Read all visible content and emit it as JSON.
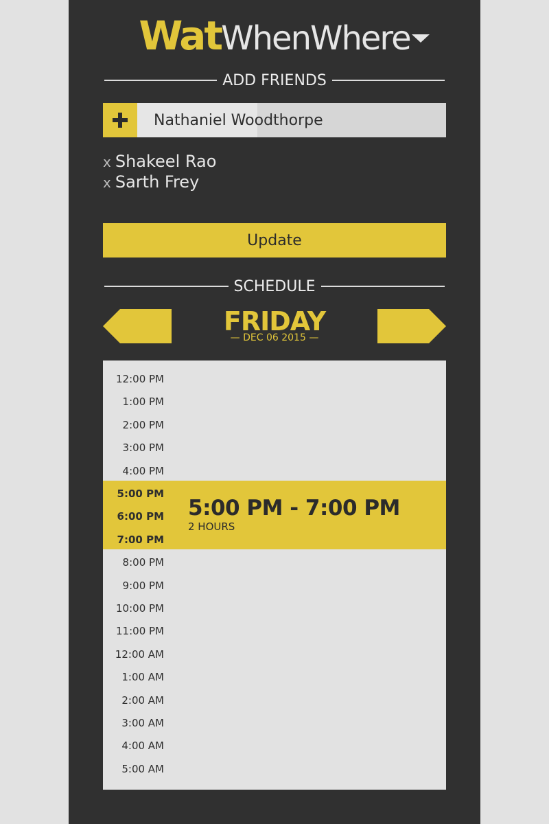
{
  "app": {
    "logo_wat": "Wat",
    "logo_rest": "WhenWhere",
    "accent": "#e2c63a",
    "background": "#303030"
  },
  "add_friends": {
    "heading": "ADD FRIENDS",
    "add_icon": "plus-icon",
    "input_value": "Nathaniel Woodthorpe",
    "friends": [
      {
        "remove_glyph": "x",
        "name": "Shakeel Rao"
      },
      {
        "remove_glyph": "x",
        "name": "Sarth Frey"
      }
    ],
    "update_label": "Update"
  },
  "schedule": {
    "heading": "SCHEDULE",
    "day": "FRIDAY",
    "date": "— DEC 06 2015 —",
    "prev_icon": "arrow-left-icon",
    "next_icon": "arrow-right-icon",
    "times": [
      "12:00 PM",
      "1:00 PM",
      "2:00 PM",
      "3:00 PM",
      "4:00 PM",
      "5:00 PM",
      "6:00 PM",
      "7:00 PM",
      "8:00 PM",
      "9:00 PM",
      "10:00 PM",
      "11:00 PM",
      "12:00 AM",
      "1:00 AM",
      "2:00 AM",
      "3:00 AM",
      "4:00 AM",
      "5:00 AM"
    ],
    "highlighted_times": [
      "5:00 PM",
      "6:00 PM",
      "7:00 PM"
    ],
    "event": {
      "range": "5:00 PM - 7:00 PM",
      "duration": "2 HOURS"
    }
  }
}
